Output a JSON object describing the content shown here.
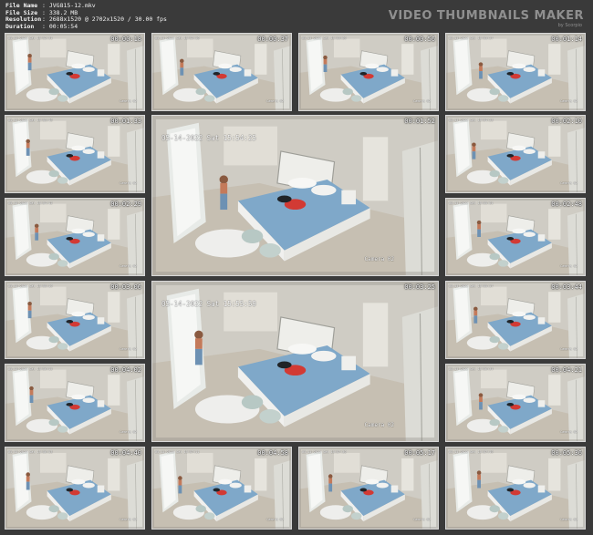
{
  "file_info": [
    {
      "label": "File Name",
      "value": ": JVG815-12.mkv"
    },
    {
      "label": "File Size",
      "value": ": 338.2 MB"
    },
    {
      "label": "Resolution",
      "value": ": 2688x1520 @ 2702x1520 / 30.00 fps"
    },
    {
      "label": "Duration",
      "value": ": 00:05:54"
    }
  ],
  "brand": {
    "title": "VIDEO THUMBNAILS MAKER",
    "subtitle": "by Scorpio"
  },
  "small_thumbs": [
    {
      "time": "00:00:18",
      "cam_date": "05-14-2022 Sat 15:52:31",
      "cam_label": "Camera 02"
    },
    {
      "time": "00:00:37",
      "cam_date": "05-14-2022 Sat 15:52:50",
      "cam_label": "Camera 02"
    },
    {
      "time": "00:00:56",
      "cam_date": "05-14-2022 Sat 15:53:09",
      "cam_label": "Camera 02"
    },
    {
      "time": "00:01:14",
      "cam_date": "05-14-2022 Sat 15:53:27",
      "cam_label": "Camera 02"
    },
    {
      "time": "00:01:33",
      "cam_date": "05-14-2022 Sat 15:53:46",
      "cam_label": "Camera 02"
    },
    {
      "time": "00:02:10",
      "cam_date": "05-14-2022 Sat 15:54:23",
      "cam_label": "Camera 02"
    },
    {
      "time": "00:02:29",
      "cam_date": "05-14-2022 Sat 15:54:42",
      "cam_label": "Camera 02"
    },
    {
      "time": "00:02:48",
      "cam_date": "05-14-2022 Sat 15:55:01",
      "cam_label": "Camera 02"
    },
    {
      "time": "00:03:06",
      "cam_date": "05-14-2022 Sat 15:55:19",
      "cam_label": "Camera 02"
    },
    {
      "time": "00:03:44",
      "cam_date": "05-14-2022 Sat 15:55:57",
      "cam_label": "Camera 02"
    },
    {
      "time": "00:04:02",
      "cam_date": "05-14-2022 Sat 15:56:15",
      "cam_label": "Camera 02"
    },
    {
      "time": "00:04:21",
      "cam_date": "05-14-2022 Sat 15:56:34",
      "cam_label": "Camera 02"
    },
    {
      "time": "00:04:40",
      "cam_date": "05-14-2022 Sat 15:56:53",
      "cam_label": "Camera 02"
    },
    {
      "time": "00:04:58",
      "cam_date": "05-14-2022 Sat 15:57:11",
      "cam_label": "Camera 02"
    },
    {
      "time": "00:05:17",
      "cam_date": "05-14-2022 Sat 15:57:30",
      "cam_label": "Camera 02"
    },
    {
      "time": "00:05:36",
      "cam_date": "05-14-2022 Sat 15:57:49",
      "cam_label": "Camera 02"
    }
  ],
  "big_thumbs": [
    {
      "time": "00:01:52",
      "cam_date": "05-14-2022 Sat 15:54:25",
      "cam_label": "Camera 02"
    },
    {
      "time": "00:03:25",
      "cam_date": "05-14-2022 Sat 15:55:59",
      "cam_label": "Camera 02"
    }
  ],
  "colors": {
    "background": "#3a3a3a",
    "thumb_border": "#d8d8d8",
    "bedding": "#7fa8c9",
    "wall": "#d2cfc8",
    "floor": "#c9c1b4"
  }
}
